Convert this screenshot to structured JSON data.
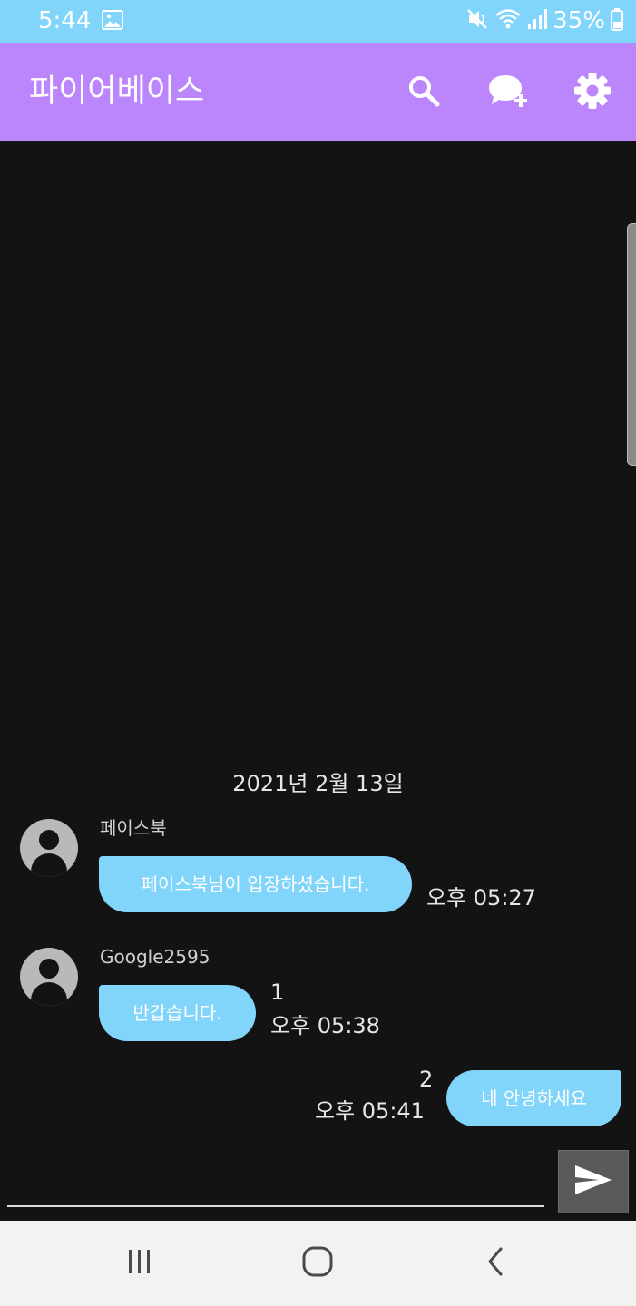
{
  "status_bar": {
    "time": "5:44",
    "battery": "35%",
    "background": "#81d4fa",
    "icons": [
      "gallery-icon",
      "mute-icon",
      "wifi-icon",
      "signal-icon",
      "battery-icon"
    ]
  },
  "app_bar": {
    "title": "파이어베이스",
    "background": "#bb86fc",
    "actions": [
      "search-icon",
      "new-chat-icon",
      "settings-icon"
    ]
  },
  "chat": {
    "date_header": "2021년 2월 13일",
    "bubble_color": "#81d4fa",
    "messages": [
      {
        "sender": "페이스북",
        "text": "페이스북님이 입장하셨습니다.",
        "time": "오후 05:27",
        "count": "",
        "side": "left"
      },
      {
        "sender": "Google2595",
        "text": "반갑습니다.",
        "time": "오후 05:38",
        "count": "1",
        "side": "left"
      },
      {
        "sender": "",
        "text": "네 안녕하세요",
        "time": "오후 05:41",
        "count": "2",
        "side": "right"
      }
    ]
  },
  "composer": {
    "value": "",
    "placeholder": "",
    "send_icon": "send-icon"
  },
  "nav_bar": {
    "buttons": [
      "recents-icon",
      "home-icon",
      "back-icon"
    ]
  }
}
